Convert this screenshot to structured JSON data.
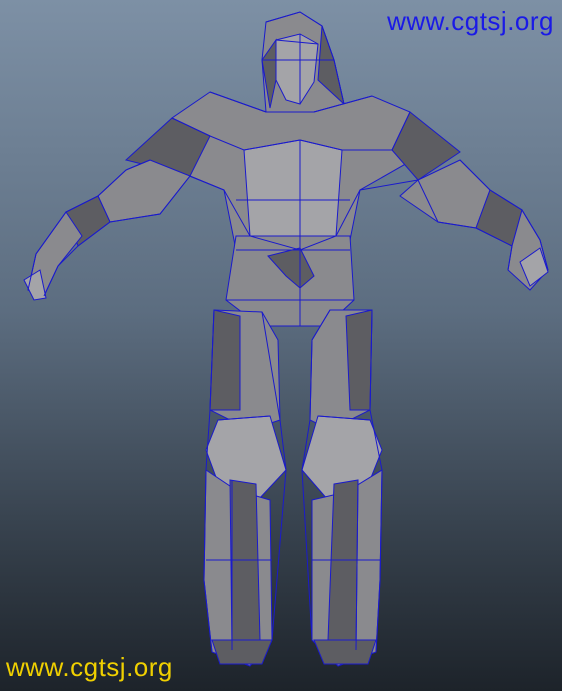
{
  "viewport": {
    "background_top": "#7d90a5",
    "background_bottom": "#1d232a",
    "model": {
      "shaded_color": "#8a8a8e",
      "dark_color": "#5d5d62",
      "light_color": "#a4a4a8",
      "wire_color": "#1a1acc"
    }
  },
  "watermarks": {
    "top": {
      "text": "www.cgtsj.org",
      "color": "#1a1ae6"
    },
    "bottom": {
      "text": "www.cgtsj.org",
      "color": "#f0d000"
    }
  }
}
